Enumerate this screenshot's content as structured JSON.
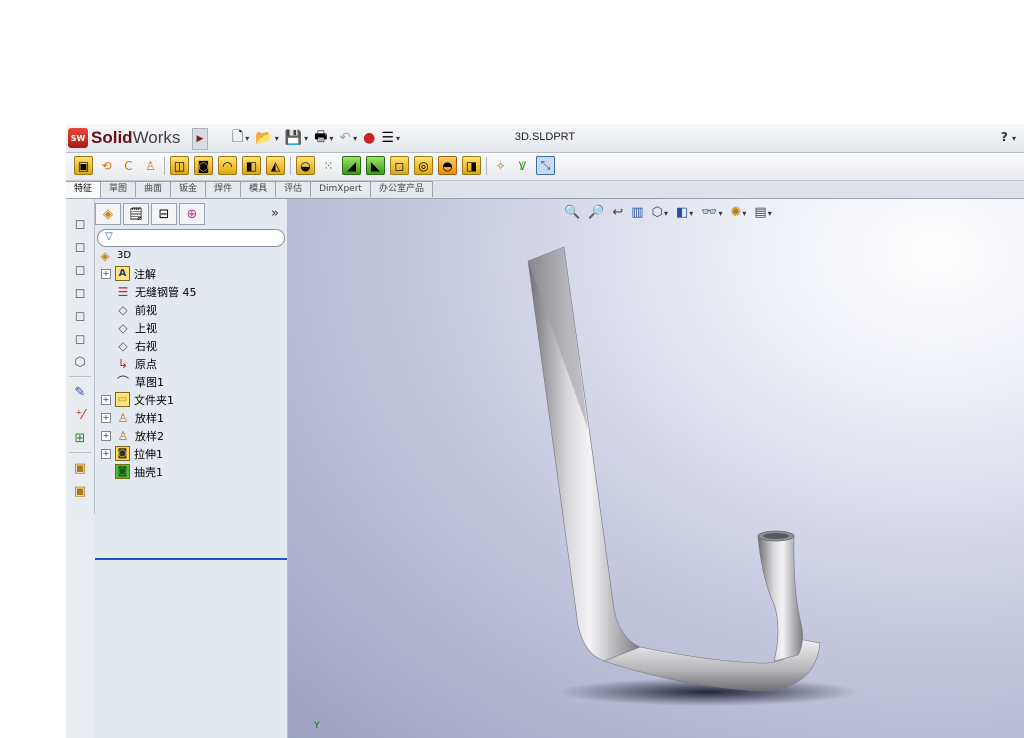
{
  "app": {
    "name_bold": "Solid",
    "name_rest": "Works",
    "document_title": "3D.SLDPRT",
    "help_label": "?"
  },
  "command_tabs": [
    "特征",
    "草图",
    "曲面",
    "钣金",
    "焊件",
    "模具",
    "评估",
    "DimXpert",
    "办公室产品"
  ],
  "feature_tree": {
    "filter_placeholder": "",
    "root": "3D",
    "items": [
      {
        "label": "注解",
        "icon": "annotation-icon",
        "expandable": true
      },
      {
        "label": "无缝钢管 45",
        "icon": "material-icon",
        "expandable": false
      },
      {
        "label": "前视",
        "icon": "plane-icon",
        "expandable": false
      },
      {
        "label": "上视",
        "icon": "plane-icon",
        "expandable": false
      },
      {
        "label": "右视",
        "icon": "plane-icon",
        "expandable": false
      },
      {
        "label": "原点",
        "icon": "origin-icon",
        "expandable": false
      },
      {
        "label": "草图1",
        "icon": "sketch-icon",
        "expandable": false
      },
      {
        "label": "文件夹1",
        "icon": "folder-icon",
        "expandable": true
      },
      {
        "label": "放样1",
        "icon": "loft-icon",
        "expandable": true
      },
      {
        "label": "放样2",
        "icon": "loft-icon",
        "expandable": true
      },
      {
        "label": "拉伸1",
        "icon": "extrude-icon",
        "expandable": true
      },
      {
        "label": "抽壳1",
        "icon": "shell-icon",
        "expandable": false
      }
    ]
  },
  "viewport": {
    "axis_label": "Y",
    "background_top": "#ffffff",
    "background_bottom": "#9ea2c2",
    "model_color": "#b8b8bc"
  },
  "colors": {
    "rollback_bar": "#1b54c4",
    "logo_red": "#c52a20"
  }
}
